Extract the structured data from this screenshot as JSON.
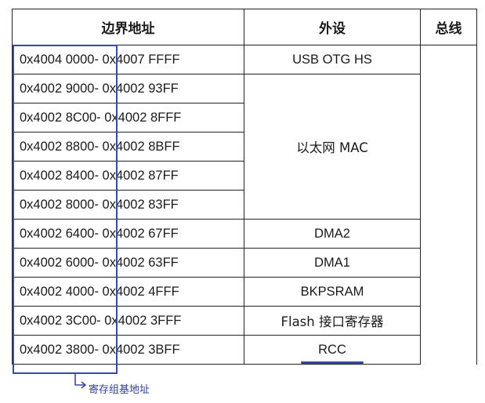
{
  "table": {
    "headers": {
      "address": "边界地址",
      "peripheral": "外设",
      "bus": "总线"
    },
    "rows": [
      {
        "start": "0x4004 0000",
        "end": "- 0x4007 FFFF"
      },
      {
        "start": "0x4002 9000",
        "end": "- 0x4002 93FF"
      },
      {
        "start": "0x4002 8C00",
        "end": "- 0x4002 8FFF"
      },
      {
        "start": "0x4002 8800",
        "end": "- 0x4002 8BFF"
      },
      {
        "start": "0x4002 8400",
        "end": "- 0x4002 87FF"
      },
      {
        "start": "0x4002 8000",
        "end": "- 0x4002 83FF"
      },
      {
        "start": "0x4002 6400",
        "end": "- 0x4002 67FF"
      },
      {
        "start": "0x4002 6000",
        "end": "- 0x4002 63FF"
      },
      {
        "start": "0x4002 4000",
        "end": "- 0x4002 4FFF"
      },
      {
        "start": "0x4002 3C00",
        "end": "- 0x4002 3FFF"
      },
      {
        "start": "0x4002 3800",
        "end": "- 0x4002 3BFF"
      }
    ],
    "peripherals": {
      "usb_otg_hs": "USB OTG HS",
      "ethernet_mac": "以太网 MAC",
      "dma2": "DMA2",
      "dma1": "DMA1",
      "bkpsram": "BKPSRAM",
      "flash_interface": "Flash 接口寄存器",
      "rcc": "RCC"
    }
  },
  "annotation": {
    "label": "寄存组基地址",
    "color": "#3a4aa3"
  }
}
